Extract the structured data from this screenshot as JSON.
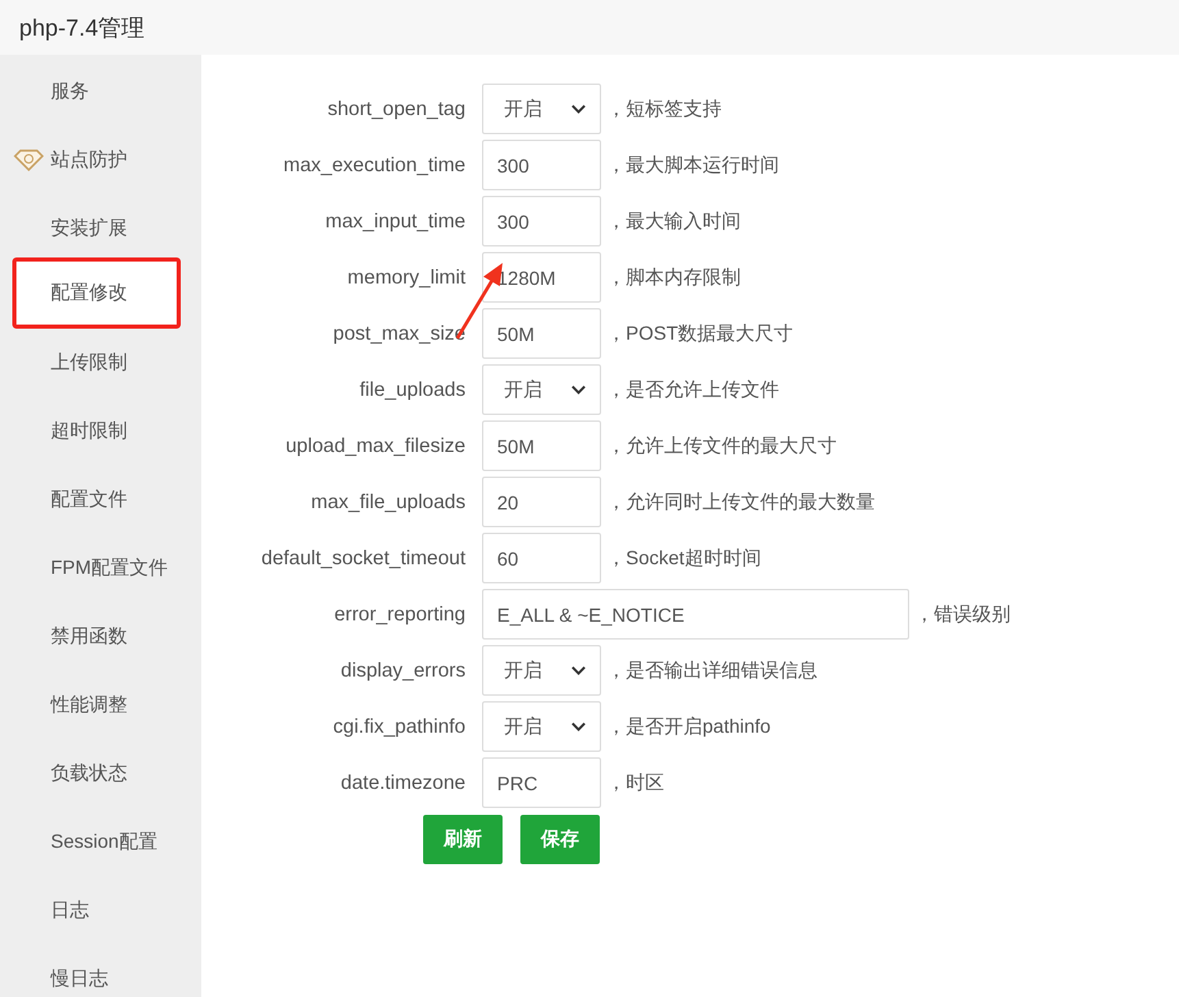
{
  "window": {
    "title": "php-7.4管理"
  },
  "sidebar": {
    "items": [
      {
        "label": "服务",
        "selected": false,
        "highlighted": false
      },
      {
        "label": "站点防护",
        "selected": false,
        "highlighted": false,
        "kind": "icon"
      },
      {
        "label": "安装扩展",
        "selected": false,
        "highlighted": false
      },
      {
        "label": "配置修改",
        "selected": true,
        "highlighted": true
      },
      {
        "label": "上传限制",
        "selected": false,
        "highlighted": false
      },
      {
        "label": "超时限制",
        "selected": false,
        "highlighted": false
      },
      {
        "label": "配置文件",
        "selected": false,
        "highlighted": false
      },
      {
        "label": "FPM配置文件",
        "selected": false,
        "highlighted": false
      },
      {
        "label": "禁用函数",
        "selected": false,
        "highlighted": false
      },
      {
        "label": "性能调整",
        "selected": false,
        "highlighted": false
      },
      {
        "label": "负载状态",
        "selected": false,
        "highlighted": false
      },
      {
        "label": "Session配置",
        "selected": false,
        "highlighted": false
      },
      {
        "label": "日志",
        "selected": false,
        "highlighted": false
      },
      {
        "label": "慢日志",
        "selected": false,
        "highlighted": false
      }
    ]
  },
  "settings": [
    {
      "name": "short_open_tag",
      "kind": "select",
      "value": "开启",
      "hint": "，短标签支持"
    },
    {
      "name": "max_execution_time",
      "kind": "text",
      "value": "300",
      "hint": "，最大脚本运行时间"
    },
    {
      "name": "max_input_time",
      "kind": "text",
      "value": "300",
      "hint": "，最大输入时间"
    },
    {
      "name": "memory_limit",
      "kind": "text",
      "value": "1280M",
      "hint": "，脚本内存限制"
    },
    {
      "name": "post_max_size",
      "kind": "text",
      "value": "50M",
      "hint": "，POST数据最大尺寸"
    },
    {
      "name": "file_uploads",
      "kind": "select",
      "value": "开启",
      "hint": "，是否允许上传文件"
    },
    {
      "name": "upload_max_filesize",
      "kind": "text",
      "value": "50M",
      "hint": "，允许上传文件的最大尺寸"
    },
    {
      "name": "max_file_uploads",
      "kind": "text",
      "value": "20",
      "hint": "，允许同时上传文件的最大数量"
    },
    {
      "name": "default_socket_timeout",
      "kind": "text",
      "value": "60",
      "hint": "，Socket超时时间"
    },
    {
      "name": "error_reporting",
      "kind": "wide",
      "value": "E_ALL & ~E_NOTICE",
      "hint": "，错误级别"
    },
    {
      "name": "display_errors",
      "kind": "select",
      "value": "开启",
      "hint": "，是否输出详细错误信息"
    },
    {
      "name": "cgi.fix_pathinfo",
      "kind": "select",
      "value": "开启",
      "hint": "，是否开启pathinfo"
    },
    {
      "name": "date.timezone",
      "kind": "text",
      "value": "PRC",
      "hint": "，时区"
    }
  ],
  "buttons": [
    "刷新",
    "保存"
  ]
}
